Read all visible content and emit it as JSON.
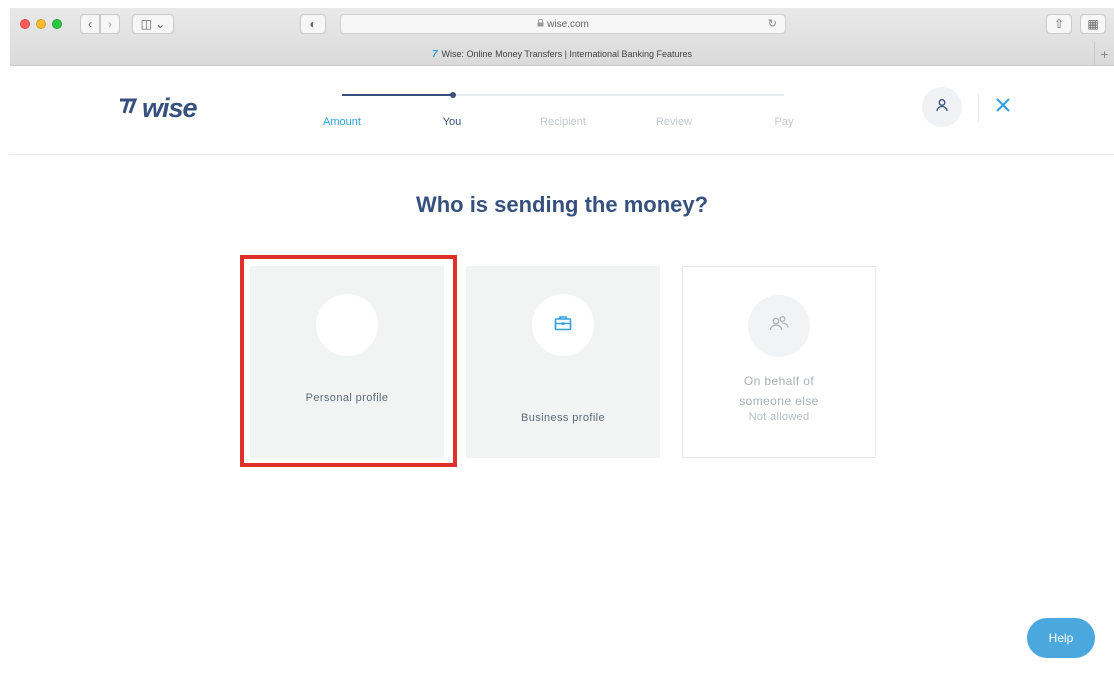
{
  "browser": {
    "url": "wise.com",
    "tab_title": "Wise: Online Money Transfers | International Banking Features",
    "tab_favicon": "7",
    "back_icon": "‹",
    "forward_icon": "›",
    "sidebar_icon": "◫ ⌄",
    "shield_icon": "◐",
    "reload_icon": "↻",
    "share_icon": "⇧",
    "tabs_icon": "▦",
    "newtab_icon": "+"
  },
  "header": {
    "logo_flag": "⁷7",
    "logo_text": "wise",
    "steps": [
      {
        "label": "Amount",
        "state": "done"
      },
      {
        "label": "You",
        "state": "current"
      },
      {
        "label": "Recipient",
        "state": "todo"
      },
      {
        "label": "Review",
        "state": "todo"
      },
      {
        "label": "Pay",
        "state": "todo"
      }
    ],
    "progress_fraction": 0.25
  },
  "main": {
    "title": "Who is sending the money?",
    "cards": {
      "personal": {
        "label": "Personal profile",
        "icon": "none"
      },
      "business": {
        "label": "Business profile",
        "icon": "briefcase-icon"
      },
      "behalf": {
        "label_line1": "On behalf of",
        "label_line2": "someone else",
        "note": "Not allowed",
        "icon": "users-icon"
      }
    },
    "highlighted_card": "personal"
  },
  "help": {
    "label": "Help"
  },
  "colors": {
    "brand_navy": "#37517e",
    "accent_blue": "#2ea0e0",
    "help_blue": "#4aa8de",
    "highlight_red": "#e0302a",
    "card_bg": "#f2f3f3"
  }
}
